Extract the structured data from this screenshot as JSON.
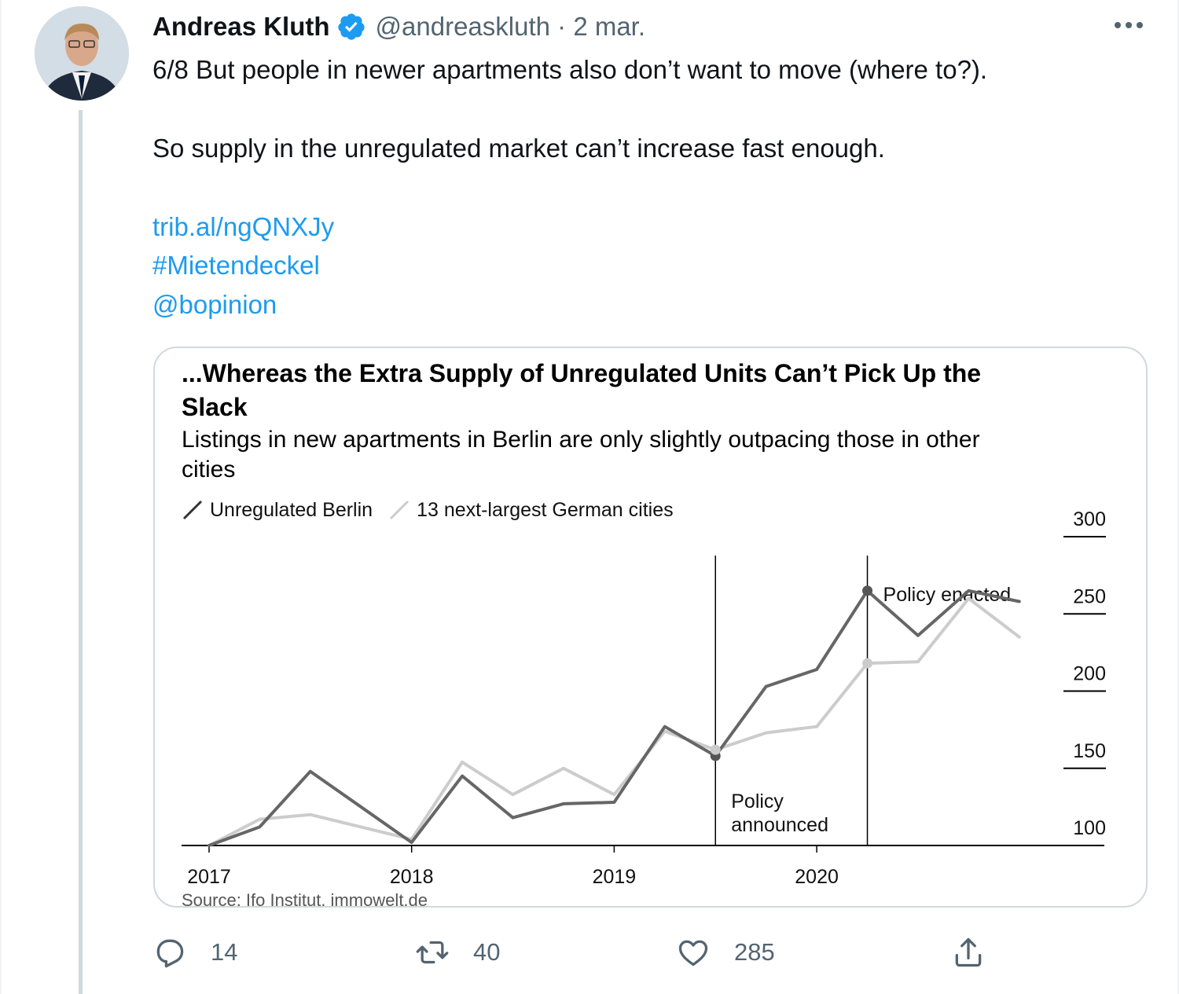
{
  "tweet": {
    "author_name": "Andreas Kluth",
    "handle_and_date": "@andreaskluth · 2 mar.",
    "text_line1": "6/8 But people in newer apartments also don’t want to move (where to?).",
    "text_line2": "So supply in the unregulated market can’t increase fast enough.",
    "link": "trib.al/ngQNXJy",
    "hashtag": "#Mietendeckel",
    "mention": "@bopinion",
    "icons": {
      "avatar": "author-avatar",
      "verified": "verified-badge-icon",
      "more": "more-options-icon"
    },
    "colors": {
      "link": "#1d9bf0",
      "secondary": "#536471",
      "verified": "#1d9bf0"
    }
  },
  "card": {
    "title_line1": "...Whereas the Extra Supply of Unregulated Units Can’t Pick Up the",
    "title_line2": "Slack",
    "subtitle_line1": "Listings in new apartments in Berlin are only slightly outpacing those in other",
    "subtitle_line2": "cities",
    "source": "Source: Ifo Institut, immowelt.de"
  },
  "chart_data": {
    "type": "line",
    "title": "...Whereas the Extra Supply of Unregulated Units Can’t Pick Up the Slack",
    "subtitle": "Listings in new apartments in Berlin are only slightly outpacing those in other cities",
    "x_ticks": [
      "2017",
      "2018",
      "2019",
      "2020"
    ],
    "x_tick_values": [
      2017.0,
      2018.0,
      2019.0,
      2020.0
    ],
    "xlim": [
      2017.0,
      2021.3
    ],
    "y_ticks": [
      "100",
      "150",
      "200",
      "250",
      "300"
    ],
    "y_tick_values": [
      100,
      150,
      200,
      250,
      300
    ],
    "ylim": [
      100,
      300
    ],
    "y_axis_side": "right",
    "legend_position": "top-left",
    "grid": false,
    "series": [
      {
        "name": "Unregulated Berlin",
        "color": "#666666",
        "x": [
          2017.0,
          2017.25,
          2017.5,
          2018.0,
          2018.25,
          2018.5,
          2018.75,
          2019.0,
          2019.25,
          2019.5,
          2019.75,
          2020.0,
          2020.25,
          2020.5,
          2020.75,
          2021.0
        ],
        "y": [
          100,
          112,
          148,
          102,
          145,
          118,
          127,
          128,
          177,
          158,
          203,
          214,
          265,
          236,
          265,
          258
        ]
      },
      {
        "name": "13 next-largest German cities",
        "color": "#cccccc",
        "x": [
          2017.0,
          2017.25,
          2017.5,
          2018.0,
          2018.25,
          2018.5,
          2018.75,
          2019.0,
          2019.25,
          2019.5,
          2019.75,
          2020.0,
          2020.25,
          2020.5,
          2020.75,
          2021.0
        ],
        "y": [
          100,
          117,
          120,
          104,
          154,
          133,
          150,
          133,
          174,
          162,
          173,
          177,
          218,
          219,
          260,
          235
        ]
      }
    ],
    "markers": [
      {
        "series": 0,
        "index": 9
      },
      {
        "series": 1,
        "index": 9
      },
      {
        "series": 0,
        "index": 12
      },
      {
        "series": 1,
        "index": 12
      }
    ],
    "annotations": [
      {
        "x": 2019.5,
        "label_lines": [
          "Policy",
          "announced"
        ]
      },
      {
        "x": 2020.25,
        "label_lines": [
          "Policy enacted"
        ]
      }
    ]
  },
  "actions": {
    "reply_count": "14",
    "retweet_count": "40",
    "like_count": "285",
    "icons": [
      "reply-icon",
      "retweet-icon",
      "like-icon",
      "share-icon"
    ]
  }
}
